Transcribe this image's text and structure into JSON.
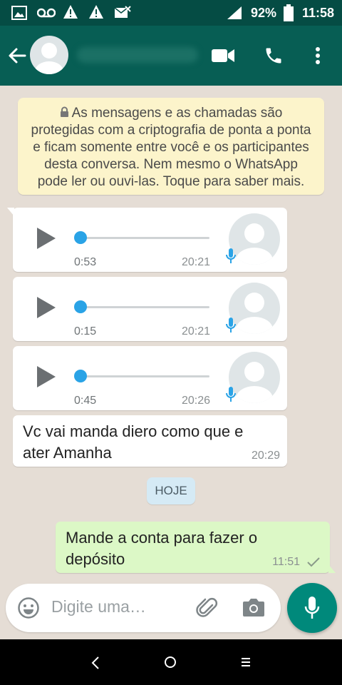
{
  "status_bar": {
    "battery": "92%",
    "time": "11:58"
  },
  "header": {
    "back_icon": "arrow-left-icon",
    "video_icon": "video-call-icon",
    "call_icon": "phone-icon",
    "menu_icon": "more-vert-icon"
  },
  "encryption_notice": "As mensagens e as chamadas são protegidas com a criptografia de ponta a ponta e ficam somente entre você e os participantes desta conversa. Nem mesmo o WhatsApp pode ler ou ouvi-las. Toque para saber mais.",
  "messages": [
    {
      "type": "voice",
      "duration": "0:53",
      "time": "20:21",
      "progress": 0
    },
    {
      "type": "voice",
      "duration": "0:15",
      "time": "20:21",
      "progress": 0
    },
    {
      "type": "voice",
      "duration": "0:45",
      "time": "20:26",
      "progress": 0
    },
    {
      "type": "text",
      "direction": "in",
      "text": "Vc vai manda diero como que e ater Amanha",
      "time": "20:29"
    }
  ],
  "date_chip": "HOJE",
  "outgoing": {
    "text": "Mande a conta para fazer o depósito",
    "time": "11:51",
    "status": "sent"
  },
  "composer": {
    "placeholder": "Digite uma…"
  },
  "colors": {
    "status_bar": "#054c44",
    "app_bar": "#075e54",
    "chat_bg": "#e5ddd5",
    "outgoing_bubble": "#dcf8c6",
    "fab": "#00897b",
    "voice_knob": "#2aa3e6"
  }
}
